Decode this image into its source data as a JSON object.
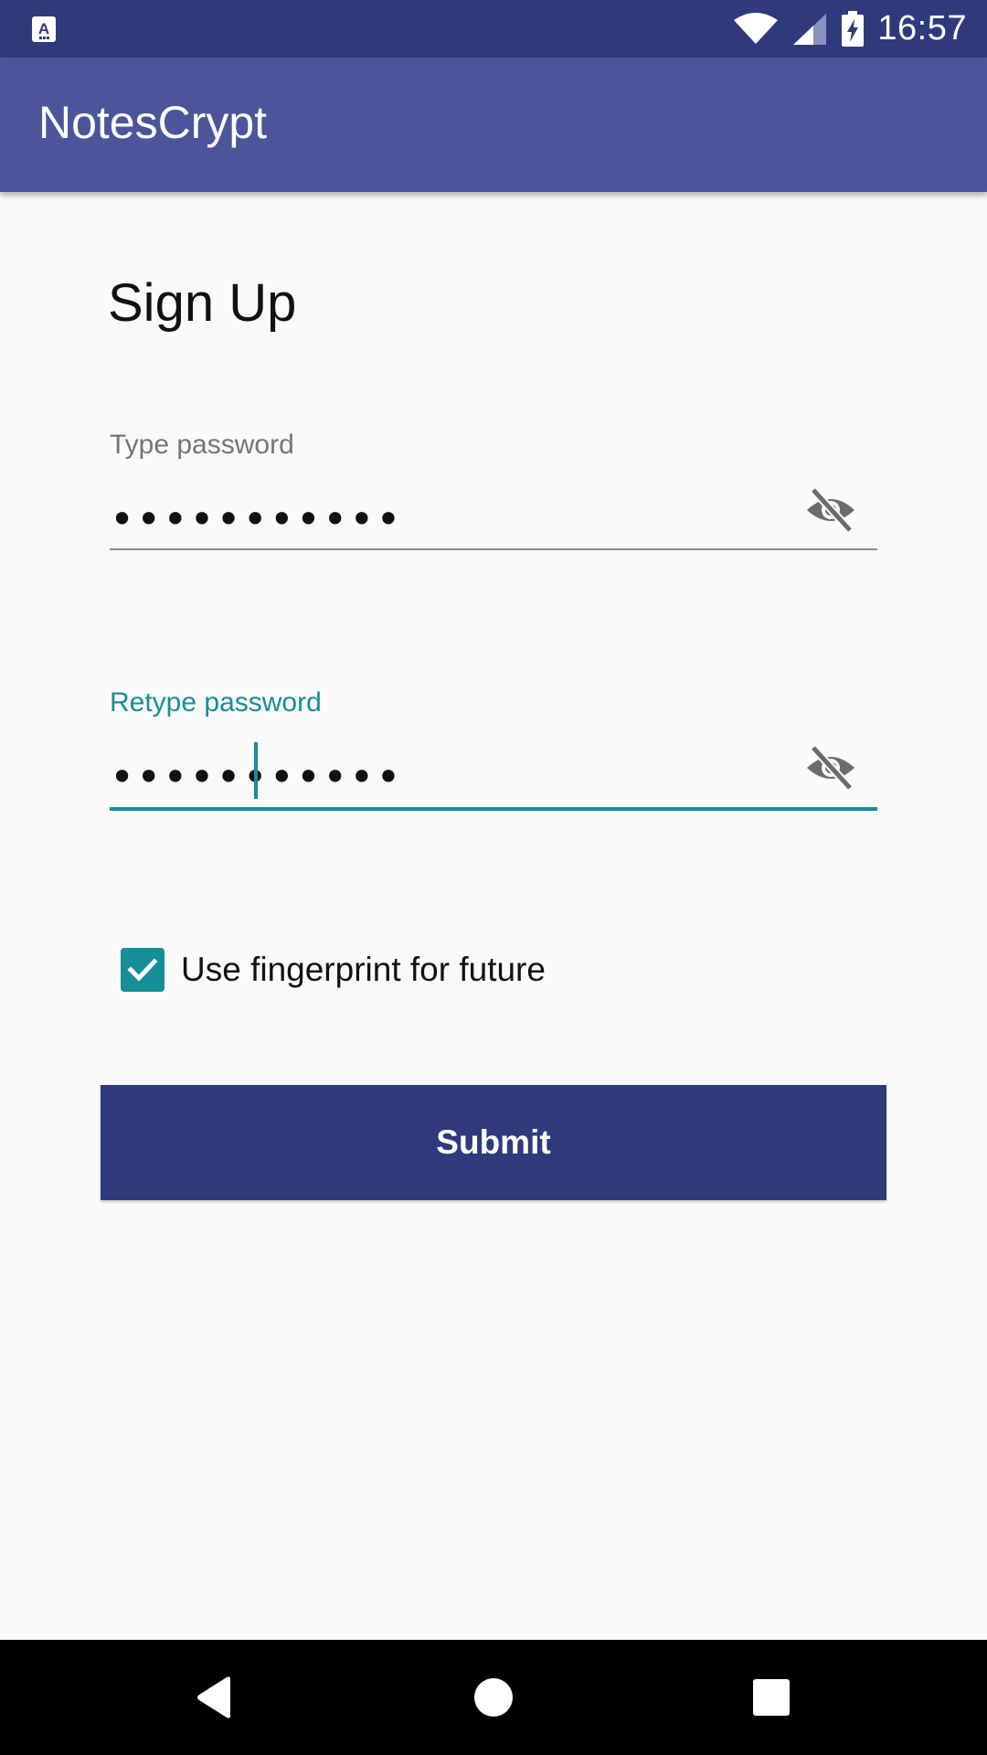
{
  "status_bar": {
    "time": "16:57",
    "icons": [
      "app-notification-icon",
      "wifi-icon",
      "cell-signal-icon",
      "battery-charging-icon"
    ]
  },
  "app_bar": {
    "title": "NotesCrypt"
  },
  "form": {
    "title": "Sign Up",
    "password": {
      "label": "Type password",
      "value": "•••••••••••",
      "toggle_icon": "visibility-off-icon",
      "label_color": "#757575"
    },
    "retype_password": {
      "label": "Retype password",
      "value": "•••••••••••",
      "toggle_icon": "visibility-off-icon",
      "label_color": "#168e98"
    },
    "fingerprint_checkbox": {
      "label": "Use fingerprint for future",
      "checked": true
    },
    "submit_label": "Submit"
  },
  "nav_bar": {
    "icons": [
      "back-icon",
      "home-icon",
      "recents-icon"
    ]
  },
  "colors": {
    "status_bar": "#2e3a7c",
    "app_bar": "#4a5699",
    "accent": "#168e98",
    "button": "#2e3a7c",
    "background": "#fafafa"
  }
}
